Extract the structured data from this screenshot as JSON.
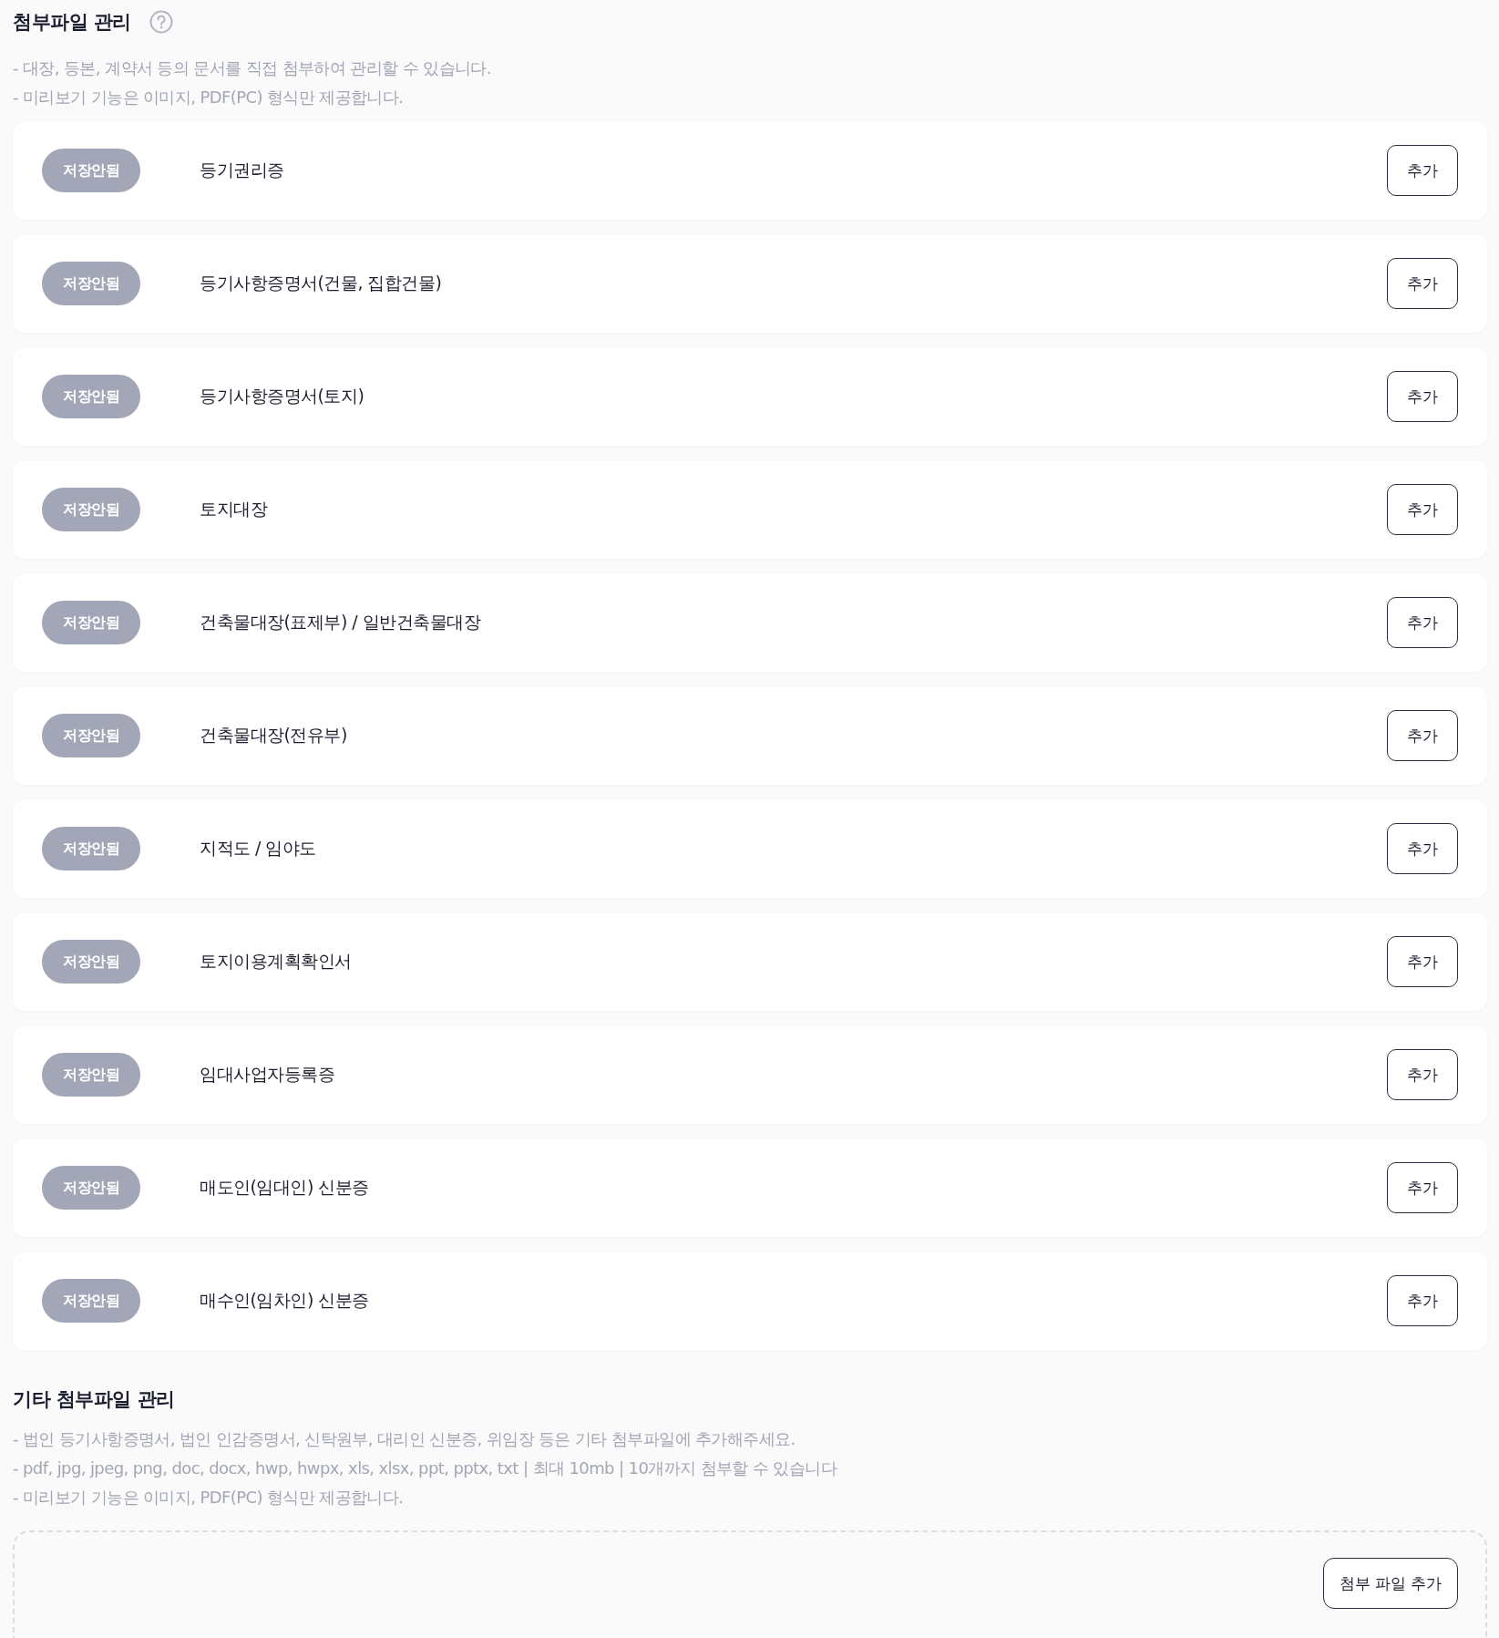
{
  "attachments": {
    "title": "첨부파일 관리",
    "notes": [
      "- 대장, 등본, 계약서 등의 문서를 직접 첨부하여 관리할 수 있습니다.",
      "- 미리보기 기능은 이미지, PDF(PC) 형식만 제공합니다."
    ],
    "items": [
      {
        "status": "저장안됨",
        "saved": false,
        "name": "등기권리증",
        "button": "추가"
      },
      {
        "status": "저장안됨",
        "saved": false,
        "name": "등기사항증명서(건물, 집합건물)",
        "button": "추가"
      },
      {
        "status": "저장안됨",
        "saved": false,
        "name": "등기사항증명서(토지)",
        "button": "추가"
      },
      {
        "status": "저장안됨",
        "saved": false,
        "name": "토지대장",
        "button": "추가"
      },
      {
        "status": "저장안됨",
        "saved": false,
        "name": "건축물대장(표제부) / 일반건축물대장",
        "button": "추가"
      },
      {
        "status": "저장안됨",
        "saved": false,
        "name": "건축물대장(전유부)",
        "button": "추가"
      },
      {
        "status": "저장안됨",
        "saved": false,
        "name": "지적도 / 임야도",
        "button": "추가"
      },
      {
        "status": "저장안됨",
        "saved": false,
        "name": "토지이용계획확인서",
        "button": "추가"
      },
      {
        "status": "저장안됨",
        "saved": false,
        "name": "임대사업자등록증",
        "button": "추가"
      },
      {
        "status": "저장안됨",
        "saved": false,
        "name": "매도인(임대인) 신분증",
        "button": "추가"
      },
      {
        "status": "저장안됨",
        "saved": false,
        "name": "매수인(임차인) 신분증",
        "button": "추가"
      }
    ]
  },
  "other_attachments": {
    "title": "기타 첨부파일 관리",
    "notes": [
      "- 법인 등기사항증명서, 법인 인감증명서, 신탁원부, 대리인 신분증, 위임장 등은 기타 첨부파일에 추가해주세요.",
      "- pdf, jpg, jpeg, png, doc, docx, hwp, hwpx, xls, xlsx, ppt, pptx, txt | 최대 10mb | 10개까지 첨부할 수 있습니다",
      "- 미리보기 기능은 이미지, PDF(PC) 형식만 제공합니다."
    ],
    "button": "첨부 파일 추가"
  }
}
